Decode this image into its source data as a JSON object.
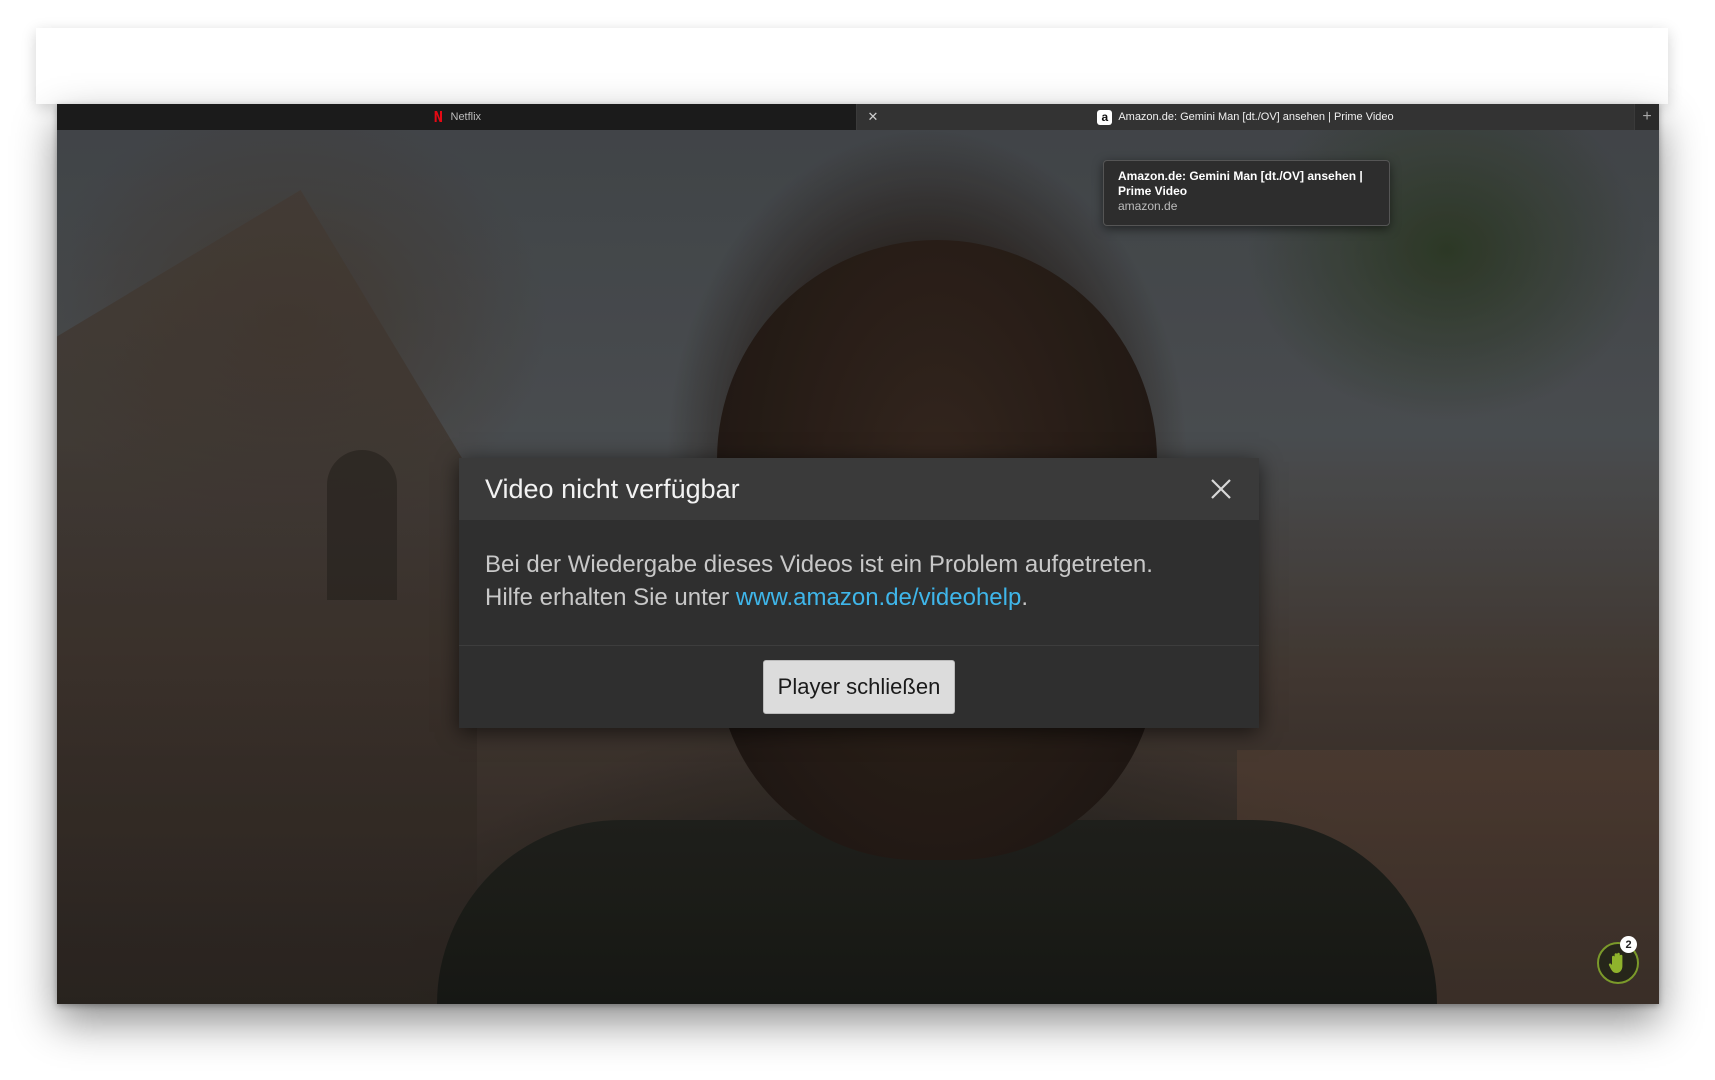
{
  "tabs": [
    {
      "label": "Netflix",
      "favicon": "netflix-n-icon",
      "active": false
    },
    {
      "label": "Amazon.de: Gemini Man [dt./OV] ansehen | Prime Video",
      "favicon": "amazon-a-icon",
      "active": true
    }
  ],
  "tooltip": {
    "title": "Amazon.de: Gemini Man [dt./OV] ansehen | Prime Video",
    "domain": "amazon.de"
  },
  "dialog": {
    "title": "Video nicht verfügbar",
    "message_line1": "Bei der Wiedergabe dieses Videos ist ein Problem aufgetreten.",
    "message_line2_prefix": "Hilfe erhalten Sie unter ",
    "help_link": "www.amazon.de/videohelp",
    "message_line2_suffix": ".",
    "close_player_label": "Player schließen"
  },
  "widget": {
    "badge_count": "2",
    "icon": "hand-icon"
  },
  "colors": {
    "link": "#3fb6ea",
    "netflix_red": "#e50914",
    "widget_green": "#7b9a2a"
  }
}
